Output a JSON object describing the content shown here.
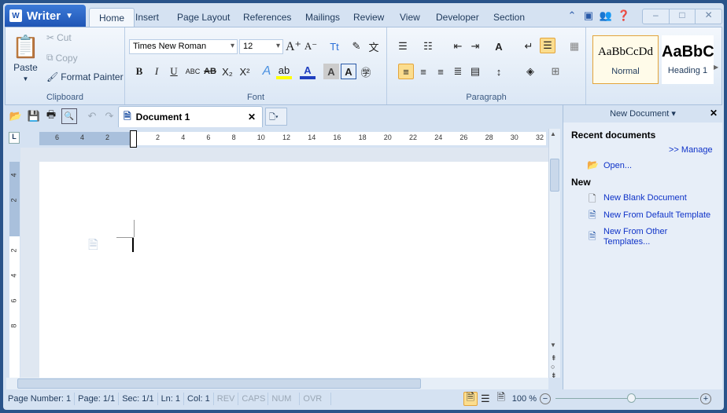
{
  "app": {
    "name": "Writer"
  },
  "tabs": [
    "Home",
    "Insert",
    "Page Layout",
    "References",
    "Mailings",
    "Review",
    "View",
    "Developer",
    "Section"
  ],
  "clipboard": {
    "paste": "Paste",
    "cut": "Cut",
    "copy": "Copy",
    "format_painter": "Format Painter",
    "label": "Clipboard"
  },
  "font": {
    "family": "Times New Roman",
    "size": "12",
    "label": "Font"
  },
  "paragraph": {
    "label": "Paragraph"
  },
  "styles": [
    {
      "preview": "AaBbCcDd",
      "name": "Normal"
    },
    {
      "preview": "AaBbC",
      "name": "Heading 1"
    }
  ],
  "document": {
    "tab": "Document 1"
  },
  "ruler": {
    "left": [
      "6",
      "4",
      "2"
    ],
    "right": [
      "2",
      "4",
      "6",
      "8",
      "10",
      "12",
      "14",
      "16",
      "18",
      "20",
      "22",
      "24",
      "26",
      "28",
      "30",
      "32"
    ],
    "vertical": [
      "4",
      "2",
      "",
      "2",
      "4",
      "6",
      "8"
    ]
  },
  "pane": {
    "title": "New Document",
    "recent": "Recent documents",
    "manage": ">> Manage",
    "open": "Open...",
    "new": "New",
    "blank": "New Blank Document",
    "default": "New From Default Template",
    "other1": "New From Other",
    "other2": "Templates..."
  },
  "status": {
    "items": [
      "Page Number: 1",
      "Page: 1/1",
      "Sec: 1/1",
      "Ln: 1",
      "Col: 1"
    ],
    "flags": [
      "REV",
      "CAPS",
      "NUM",
      "OVR"
    ],
    "zoom": "100 %"
  },
  "zoom_level": 100,
  "colors": {
    "accent": "#1f55b5",
    "highlight": "#fbdd8e"
  }
}
